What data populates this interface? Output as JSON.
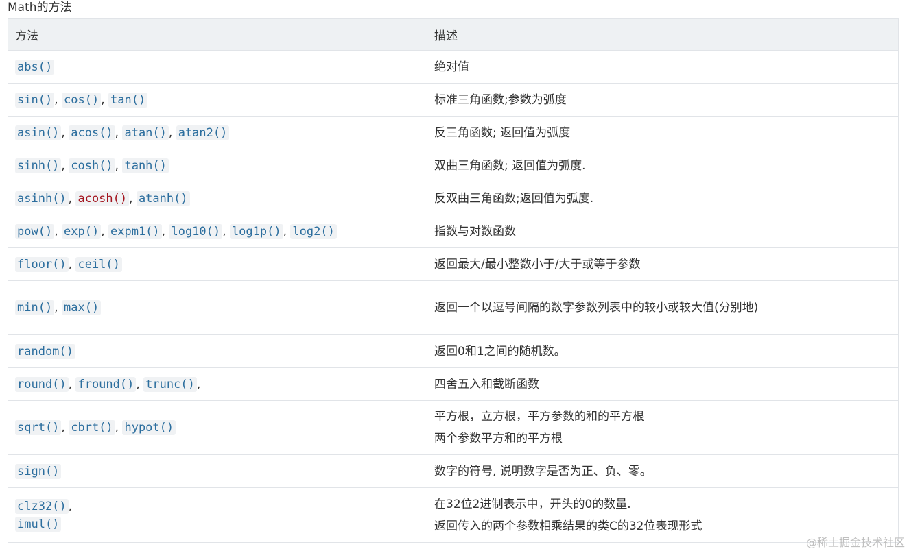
{
  "caption": "Math的方法",
  "headers": [
    "方法",
    "描述"
  ],
  "rows": [
    {
      "methods": [
        "abs()"
      ],
      "trail": "",
      "desc": [
        "绝对值"
      ],
      "height": 48
    },
    {
      "methods": [
        "sin()",
        "cos()",
        "tan()"
      ],
      "trail": "",
      "desc": [
        "标准三角函数;参数为弧度"
      ],
      "height": 48
    },
    {
      "methods": [
        "asin()",
        "acos()",
        "atan()",
        "atan2()"
      ],
      "trail": "",
      "desc": [
        "反三角函数; 返回值为弧度"
      ],
      "height": 48
    },
    {
      "methods": [
        "sinh()",
        "cosh()",
        "tanh()"
      ],
      "trail": "",
      "desc": [
        "双曲三角函数; 返回值为弧度."
      ],
      "height": 48
    },
    {
      "methods": [
        "asinh()",
        "acosh()",
        "atanh()"
      ],
      "highlight": [
        1
      ],
      "trail": "",
      "desc": [
        "反双曲三角函数;返回值为弧度."
      ],
      "height": 48
    },
    {
      "methods": [
        "pow()",
        "exp()",
        "expm1()",
        "log10()",
        "log1p()",
        "log2()"
      ],
      "trail": "",
      "desc": [
        "指数与对数函数"
      ],
      "height": 48
    },
    {
      "methods": [
        "floor()",
        "ceil()"
      ],
      "trail": "",
      "desc": [
        "返回最大/最小整数小于/大于或等于参数"
      ],
      "height": 48
    },
    {
      "methods": [
        "min()",
        "max()"
      ],
      "trail": "",
      "desc": [
        "",
        "返回一个以逗号间隔的数字参数列表中的较小或较大值(分别地)"
      ],
      "height": 79
    },
    {
      "methods": [
        "random()"
      ],
      "trail": "",
      "desc": [
        "返回0和1之间的随机数。"
      ],
      "height": 48
    },
    {
      "methods": [
        "round()",
        "fround()",
        "trunc()"
      ],
      "trail": ",",
      "desc": [
        "四舍五入和截断函数"
      ],
      "height": 48
    },
    {
      "methods": [
        "sqrt()",
        "cbrt()",
        "hypot()"
      ],
      "trail": "",
      "desc": [
        "平方根，立方根，平方参数的和的平方根",
        "两个参数平方和的平方根"
      ],
      "height": 79
    },
    {
      "methods": [
        "sign()"
      ],
      "trail": "",
      "desc": [
        "数字的符号, 说明数字是否为正、负、零。"
      ],
      "height": 48
    },
    {
      "methods": [
        "clz32()",
        "imul()"
      ],
      "trail": "",
      "stacked": true,
      "desc": [
        "在32位2进制表示中，开头的0的数量.",
        "返回传入的两个参数相乘结果的类C的32位表现形式"
      ],
      "height": 80
    }
  ],
  "watermark": "@稀土掘金技术社区"
}
